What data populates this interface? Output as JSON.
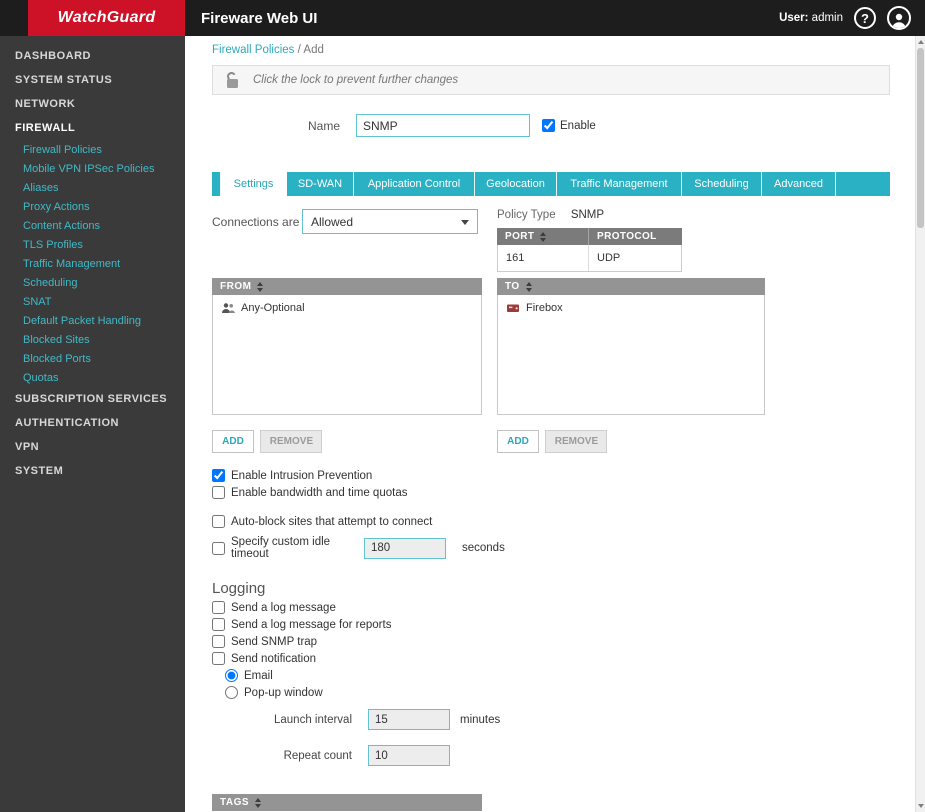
{
  "header": {
    "logo_text": "WatchGuard",
    "app_title": "Fireware Web UI",
    "user_label": "User:",
    "user_name": "admin",
    "help_glyph": "?"
  },
  "sidebar": {
    "sections": [
      {
        "label": "DASHBOARD"
      },
      {
        "label": "SYSTEM STATUS"
      },
      {
        "label": "NETWORK"
      },
      {
        "label": "FIREWALL",
        "expanded": true
      },
      {
        "label": "SUBSCRIPTION SERVICES"
      },
      {
        "label": "AUTHENTICATION"
      },
      {
        "label": "VPN"
      },
      {
        "label": "SYSTEM"
      }
    ],
    "firewall_children": [
      {
        "label": "Firewall Policies",
        "active": true
      },
      {
        "label": "Mobile VPN IPSec Policies"
      },
      {
        "label": "Aliases"
      },
      {
        "label": "Proxy Actions"
      },
      {
        "label": "Content Actions"
      },
      {
        "label": "TLS Profiles"
      },
      {
        "label": "Traffic Management"
      },
      {
        "label": "Scheduling"
      },
      {
        "label": "SNAT"
      },
      {
        "label": "Default Packet Handling"
      },
      {
        "label": "Blocked Sites"
      },
      {
        "label": "Blocked Ports"
      },
      {
        "label": "Quotas"
      }
    ]
  },
  "breadcrumb": {
    "link": "Firewall Policies",
    "separator": "/",
    "current": "Add"
  },
  "lock_banner": {
    "message": "Click the lock to prevent further changes",
    "icon": "open-padlock-icon"
  },
  "policy_form": {
    "name_label": "Name",
    "name_value": "SNMP",
    "enable_label": "Enable",
    "enable_checked": true
  },
  "tabs": [
    {
      "label": "Settings",
      "active": true
    },
    {
      "label": "SD-WAN"
    },
    {
      "label": "Application Control"
    },
    {
      "label": "Geolocation"
    },
    {
      "label": "Traffic Management"
    },
    {
      "label": "Scheduling"
    },
    {
      "label": "Advanced"
    }
  ],
  "settings_tab": {
    "connections_label": "Connections are",
    "connections_value": "Allowed",
    "policy_type_label": "Policy Type",
    "policy_type_value": "SNMP",
    "port_table": {
      "col_port": "PORT",
      "col_protocol": "PROTOCOL",
      "rows": [
        {
          "port": "161",
          "protocol": "UDP"
        }
      ]
    },
    "from_list": {
      "header": "FROM",
      "items": [
        {
          "label": "Any-Optional",
          "icon": "alias-icon"
        }
      ],
      "add": "ADD",
      "remove": "REMOVE"
    },
    "to_list": {
      "header": "TO",
      "items": [
        {
          "label": "Firebox",
          "icon": "firebox-icon"
        }
      ],
      "add": "ADD",
      "remove": "REMOVE"
    },
    "options": {
      "intrusion": {
        "label": "Enable Intrusion Prevention",
        "checked": true
      },
      "bandwidth_quotas": {
        "label": "Enable bandwidth and time quotas",
        "checked": false
      },
      "auto_block": {
        "label": "Auto-block sites that attempt to connect",
        "checked": false
      },
      "idle_timeout": {
        "label": "Specify custom idle timeout",
        "checked": false,
        "value": "180",
        "unit": "seconds"
      }
    },
    "logging": {
      "title": "Logging",
      "send_log": {
        "label": "Send a log message",
        "checked": false
      },
      "send_log_reports": {
        "label": "Send a log message for reports",
        "checked": false
      },
      "send_snmp_trap": {
        "label": "Send SNMP trap",
        "checked": false
      },
      "send_notification": {
        "label": "Send notification",
        "checked": false
      },
      "notify_email": {
        "label": "Email",
        "selected": true
      },
      "notify_popup": {
        "label": "Pop-up window",
        "selected": false
      },
      "launch_interval": {
        "label": "Launch interval",
        "value": "15",
        "unit": "minutes"
      },
      "repeat_count": {
        "label": "Repeat count",
        "value": "10"
      }
    },
    "tags_header": "TAGS"
  },
  "colors": {
    "brand_red": "#cd1126",
    "accent_teal": "#2ab1c4",
    "sidebar_link": "#41b9c7",
    "header_gray": "#949494"
  }
}
